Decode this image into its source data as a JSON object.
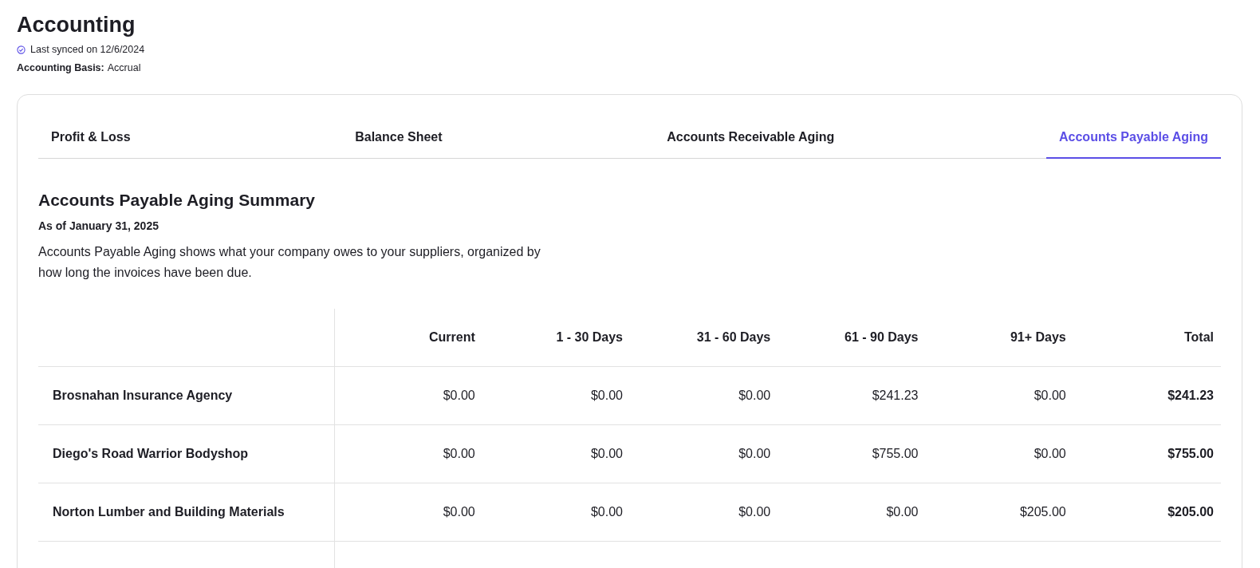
{
  "page": {
    "title": "Accounting",
    "sync_status": "Last synced on 12/6/2024",
    "basis_label": "Accounting Basis:",
    "basis_value": "Accrual"
  },
  "tabs": [
    {
      "label": "Profit & Loss",
      "selected": false
    },
    {
      "label": "Balance Sheet",
      "selected": false
    },
    {
      "label": "Accounts Receivable Aging",
      "selected": false
    },
    {
      "label": "Accounts Payable Aging",
      "selected": true
    }
  ],
  "report": {
    "title": "Accounts Payable Aging Summary",
    "date": "As of January 31, 2025",
    "description": "Accounts Payable Aging shows what your company owes to your suppliers, organized by how long the invoices have been due."
  },
  "table": {
    "columns": [
      "Current",
      "1 - 30 Days",
      "31 - 60 Days",
      "61 - 90 Days",
      "91+ Days",
      "Total"
    ],
    "rows": [
      {
        "name": "Brosnahan Insurance Agency",
        "values": [
          "$0.00",
          "$0.00",
          "$0.00",
          "$241.23",
          "$0.00"
        ],
        "total": "$241.23"
      },
      {
        "name": "Diego's Road Warrior Bodyshop",
        "values": [
          "$0.00",
          "$0.00",
          "$0.00",
          "$755.00",
          "$0.00"
        ],
        "total": "$755.00"
      },
      {
        "name": "Norton Lumber and Building Materials",
        "values": [
          "$0.00",
          "$0.00",
          "$0.00",
          "$0.00",
          "$205.00"
        ],
        "total": "$205.00"
      }
    ]
  }
}
